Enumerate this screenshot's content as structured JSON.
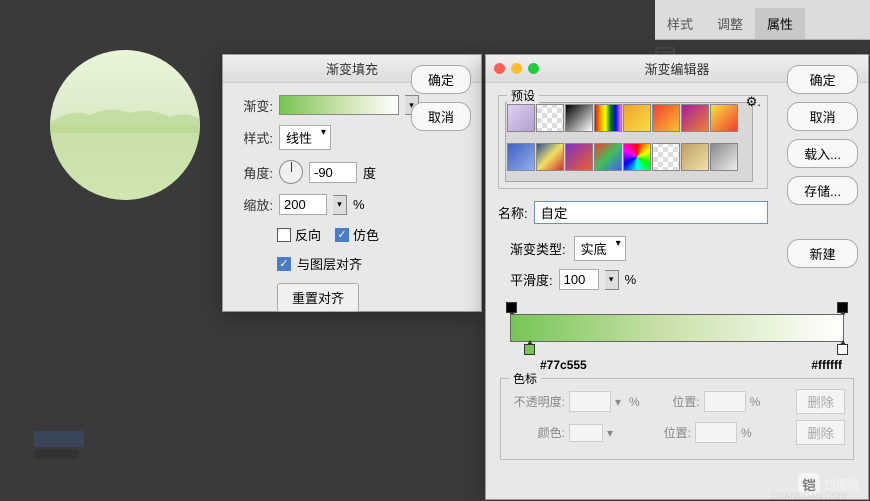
{
  "tabs": {
    "style": "样式",
    "adjust": "调整",
    "properties": "属性"
  },
  "gradient_fill": {
    "title": "渐变填充",
    "gradient_label": "渐变:",
    "style_label": "样式:",
    "style_value": "线性",
    "angle_label": "角度:",
    "angle_value": "-90",
    "angle_unit": "度",
    "scale_label": "缩放:",
    "scale_value": "200",
    "scale_unit": "%",
    "reverse_label": "反向",
    "dither_label": "仿色",
    "align_label": "与图层对齐",
    "reset_button": "重置对齐",
    "ok": "确定",
    "cancel": "取消"
  },
  "gradient_editor": {
    "title": "渐变编辑器",
    "presets_label": "预设",
    "name_label": "名称:",
    "name_value": "自定",
    "type_label": "渐变类型:",
    "type_value": "实底",
    "smooth_label": "平滑度:",
    "smooth_value": "100",
    "smooth_unit": "%",
    "color_left": "#77c555",
    "color_right": "#ffffff",
    "stops_label": "色标",
    "opacity_label": "不透明度:",
    "position_label": "位置:",
    "color_label": "颜色:",
    "delete_btn": "删除",
    "percent": "%",
    "ok": "确定",
    "cancel": "取消",
    "load": "载入...",
    "save": "存储...",
    "new": "新建"
  },
  "watermark": {
    "text": "铠图网",
    "sub": "DDANDDAN.COM"
  }
}
